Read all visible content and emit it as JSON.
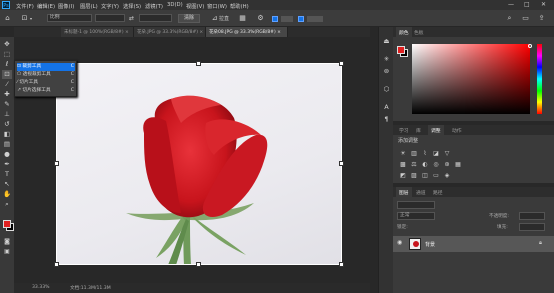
{
  "menubar": {
    "logo": "Ps",
    "items": [
      "文件(F)",
      "编辑(E)",
      "图像(I)",
      "图层(L)",
      "文字(Y)",
      "选择(S)",
      "滤镜(T)",
      "3D(D)",
      "视图(V)",
      "窗口(W)",
      "帮助(H)"
    ],
    "controls": [
      "—",
      "□",
      "✕"
    ]
  },
  "options_bar": {
    "ratio_value": "比例",
    "clear_label": "清除",
    "straighten_label": "拉直"
  },
  "doc_tabs": [
    {
      "label": "未标题-1 @ 100%(RGB/8#) ×",
      "active": false
    },
    {
      "label": "花朵.JPG @ 33.3%(RGB/8#) ×",
      "active": false
    },
    {
      "label": "花朵08.JPG @ 33.3%(RGB/8#) ×",
      "active": true
    }
  ],
  "tool_flyout": [
    {
      "label": "裁剪工具",
      "shortcut": "C",
      "selected": true
    },
    {
      "label": "透视裁剪工具",
      "shortcut": "C",
      "selected": false
    },
    {
      "label": "切片工具",
      "shortcut": "C",
      "selected": false
    },
    {
      "label": "切片选择工具",
      "shortcut": "C",
      "selected": false
    }
  ],
  "status_bar": {
    "zoom": "33.33%",
    "doc_info": "文档:11.3M/11.3M"
  },
  "color_panel": {
    "tabs": [
      "颜色",
      "色板"
    ],
    "foreground": "#e02020",
    "background": "#000000"
  },
  "adjust_panel": {
    "tabs": [
      "学习",
      "库",
      "调整",
      "动作"
    ],
    "title": "添加调整"
  },
  "layers_panel": {
    "tabs": [
      "图层",
      "通道",
      "路径"
    ],
    "blend_mode": "正常",
    "opacity_label": "不透明度:",
    "fill_label": "填充:",
    "lock_label": "锁定:",
    "layer_name": "背景"
  },
  "colors": {
    "accent": "#1473e6",
    "rose": "#c8141c"
  }
}
